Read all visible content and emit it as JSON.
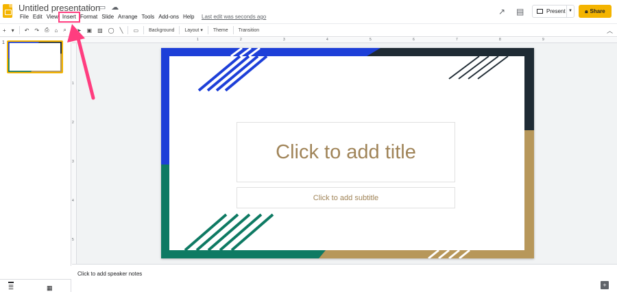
{
  "header": {
    "title": "Untitled presentation",
    "last_edit": "Last edit was seconds ago",
    "present_label": "Present",
    "share_label": "Share",
    "icons": [
      "star-icon",
      "folder-icon",
      "cloud-icon",
      "trend-icon",
      "comment-icon",
      "lock-icon"
    ]
  },
  "menu": {
    "items": [
      "File",
      "Edit",
      "View",
      "Insert",
      "Format",
      "Slide",
      "Arrange",
      "Tools",
      "Add-ons",
      "Help"
    ],
    "highlighted": "Insert"
  },
  "toolbar": {
    "background": "Background",
    "layout": "Layout",
    "theme": "Theme",
    "transition": "Transition"
  },
  "filmstrip": {
    "slide_number": "1"
  },
  "ruler": {
    "h_ticks": [
      "1",
      "2",
      "3",
      "4",
      "5",
      "6",
      "7",
      "8",
      "9"
    ],
    "v_ticks": [
      "1",
      "2",
      "3",
      "4",
      "5"
    ]
  },
  "slide": {
    "title_placeholder": "Click to add title",
    "subtitle_placeholder": "Click to add subtitle"
  },
  "notes": {
    "placeholder": "Click to add speaker notes"
  },
  "colors": {
    "accent": "#f4b400",
    "annotation": "#ff3d7f",
    "slide_blue": "#1d3fd8",
    "slide_navy": "#1f2b34",
    "slide_teal": "#0e7a63",
    "slide_gold": "#b7975a",
    "placeholder_text": "#a08458"
  }
}
